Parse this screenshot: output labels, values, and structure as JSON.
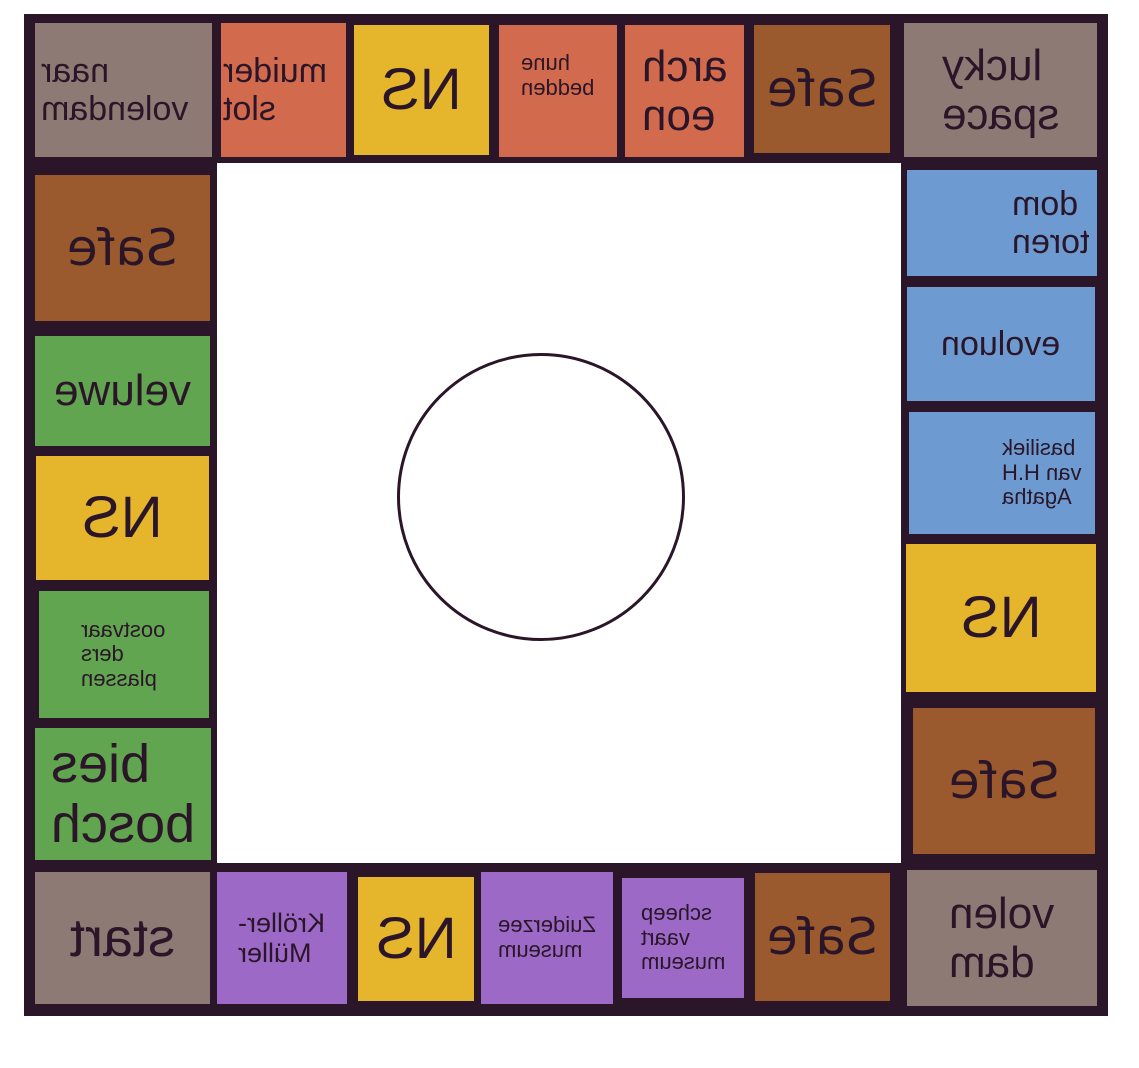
{
  "colors": {
    "frame": "#2a1628",
    "corner_grey": "#8d7a74",
    "orange": "#d26a4d",
    "yellow": "#e5b52b",
    "brown": "#9a5a2e",
    "blue": "#6d9bd1",
    "green": "#61a550",
    "purple": "#9c6ac6"
  },
  "text_mirrored": true,
  "top_row": {
    "naar_volendam": "naar\nvolendam",
    "muiderslot": "muider\nslot",
    "ns": "NS",
    "hunebedden": "hune\nbedden",
    "archeon": "arch\neon",
    "safe": "Safe",
    "lucky_space": "lucky\nspace"
  },
  "left_column": {
    "safe": "Safe",
    "veluwe": "veluwe",
    "ns": "NS",
    "oostvaardersplassen": "oostvaar\nders\nplassen",
    "biesbosch": "bies\nbosch"
  },
  "right_column": {
    "domtoren": "dom\ntoren",
    "evoluon": "evoluon",
    "basiliek": "basiliek\nvan H.H\nAgatha",
    "ns": "NS",
    "safe": "Safe"
  },
  "bottom_row": {
    "start": "start",
    "kroller_muller": "Kröller-\nMüller",
    "ns": "NS",
    "zuiderzeemuseum": "Zuiderzee\nmuseum",
    "scheepvaartmuseum": "scheep\nvaart\nmuseum",
    "safe": "Safe",
    "volendam": "volen\ndam"
  }
}
